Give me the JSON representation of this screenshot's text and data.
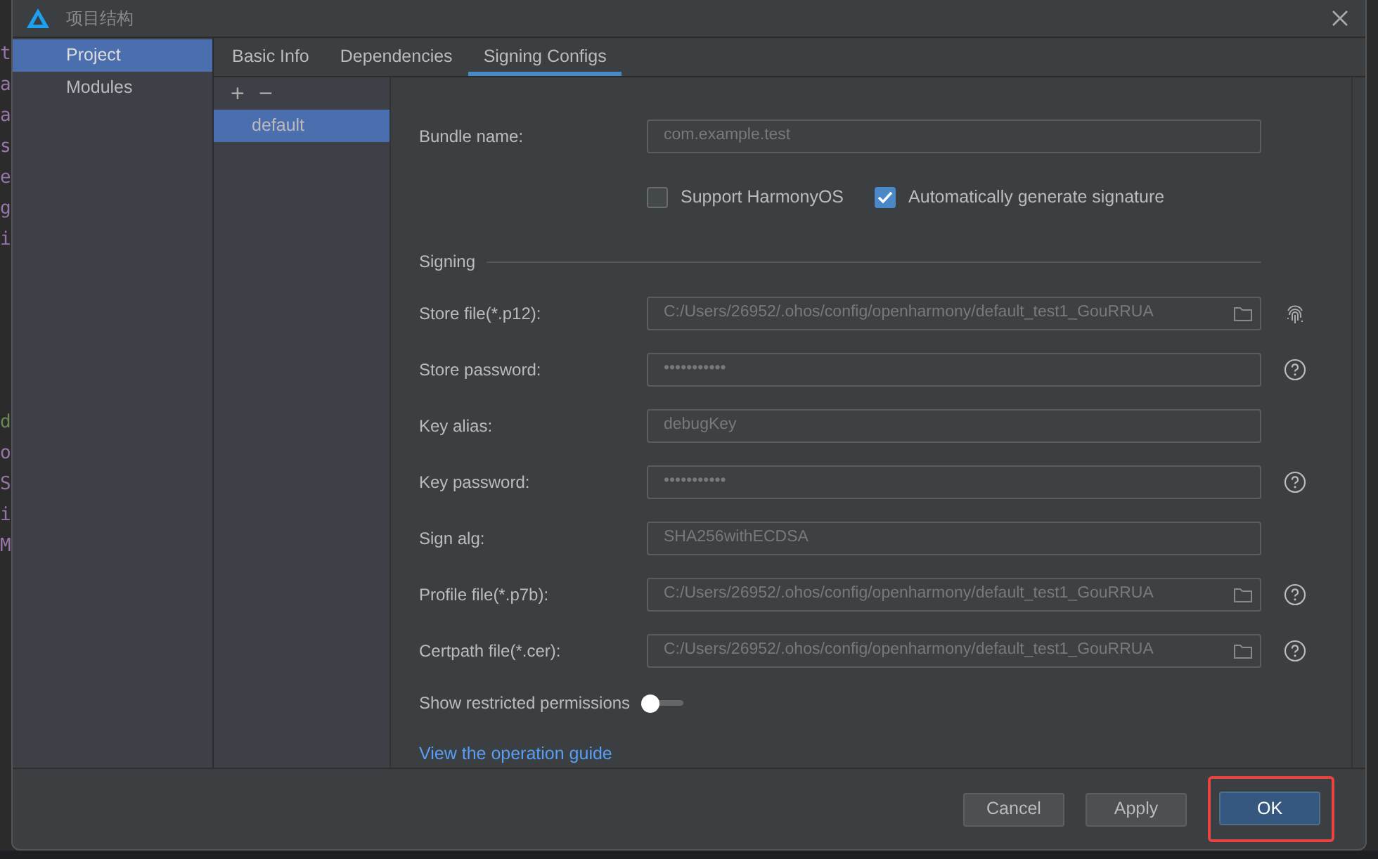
{
  "background_editor": {
    "top_letters": [
      "t",
      "a",
      "a",
      "s",
      "e",
      "g",
      "i"
    ],
    "bottom_letters": [
      "d",
      "o",
      "S",
      "i",
      "M"
    ]
  },
  "window": {
    "title": "项目结构"
  },
  "sidebar": {
    "items": [
      {
        "label": "Project",
        "selected": true
      },
      {
        "label": "Modules",
        "selected": false
      }
    ]
  },
  "tabs": [
    {
      "label": "Basic Info",
      "selected": false
    },
    {
      "label": "Dependencies",
      "selected": false
    },
    {
      "label": "Signing Configs",
      "selected": true
    }
  ],
  "configs": {
    "add": "+",
    "remove": "−",
    "items": [
      {
        "label": "default",
        "selected": true
      }
    ]
  },
  "bundle": {
    "label": "Bundle name:",
    "value": "com.example.test",
    "disabled": true
  },
  "checkboxes": [
    {
      "label": "Support HarmonyOS",
      "checked": false
    },
    {
      "label": "Automatically generate signature",
      "checked": true
    }
  ],
  "signing": {
    "title": "Signing",
    "fields": [
      {
        "label": "Store file(*.p12):",
        "value": "C:/Users/26952/.ohos/config/openharmony/default_test1_GouRRUA",
        "kind": "file",
        "fingerprint": true,
        "help": false,
        "disabled": true
      },
      {
        "label": "Store password:",
        "value": "•••••••••••",
        "kind": "password",
        "fingerprint": false,
        "help": true,
        "disabled": true
      },
      {
        "label": "Key alias:",
        "value": "debugKey",
        "kind": "text",
        "fingerprint": false,
        "help": false,
        "disabled": true
      },
      {
        "label": "Key password:",
        "value": "•••••••••••",
        "kind": "password",
        "fingerprint": false,
        "help": true,
        "disabled": true
      },
      {
        "label": "Sign alg:",
        "value": "SHA256withECDSA",
        "kind": "text",
        "fingerprint": false,
        "help": false,
        "disabled": true
      },
      {
        "label": "Profile file(*.p7b):",
        "value": "C:/Users/26952/.ohos/config/openharmony/default_test1_GouRRUA",
        "kind": "file",
        "fingerprint": false,
        "help": true,
        "disabled": true
      },
      {
        "label": "Certpath file(*.cer):",
        "value": "C:/Users/26952/.ohos/config/openharmony/default_test1_GouRRUA",
        "kind": "file",
        "fingerprint": false,
        "help": true,
        "disabled": true
      }
    ]
  },
  "toggle": {
    "label": "Show restricted permissions",
    "on": false
  },
  "link": "View the operation guide",
  "buttons": [
    {
      "label": "Cancel",
      "kind": "default",
      "highlighted": false
    },
    {
      "label": "Apply",
      "kind": "default",
      "highlighted": false
    },
    {
      "label": "OK",
      "kind": "primary",
      "highlighted": true
    }
  ]
}
